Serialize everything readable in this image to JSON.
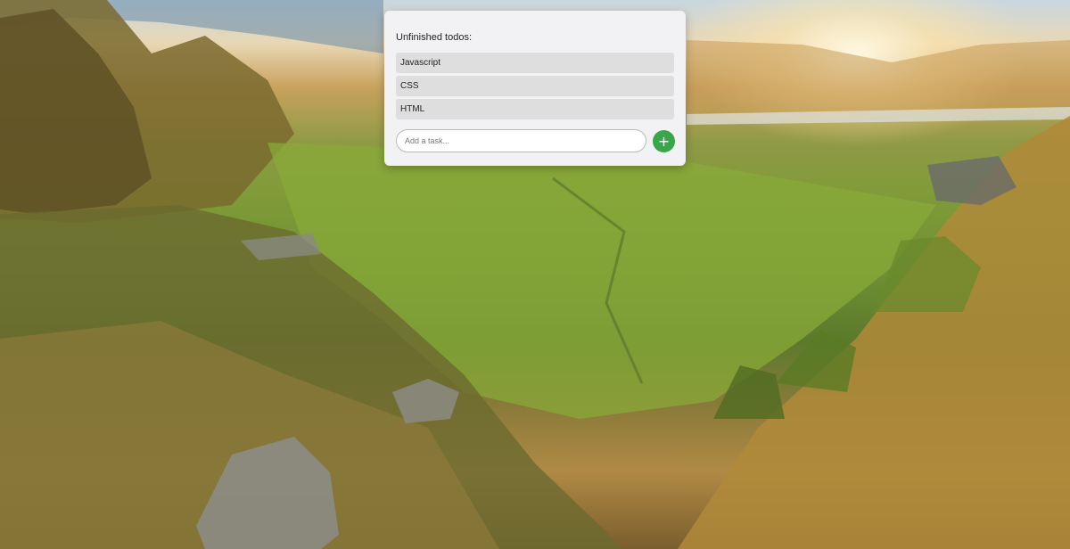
{
  "todo_card": {
    "title": "Unfinished todos:",
    "items": [
      {
        "label": "Javascript"
      },
      {
        "label": "CSS"
      },
      {
        "label": "HTML"
      }
    ],
    "input": {
      "value": "",
      "placeholder": "Add a task..."
    },
    "add_button": {
      "icon": "plus-icon",
      "symbol": "+",
      "color": "#3aa64a"
    }
  },
  "background": {
    "description_type": "landscape-photo"
  }
}
